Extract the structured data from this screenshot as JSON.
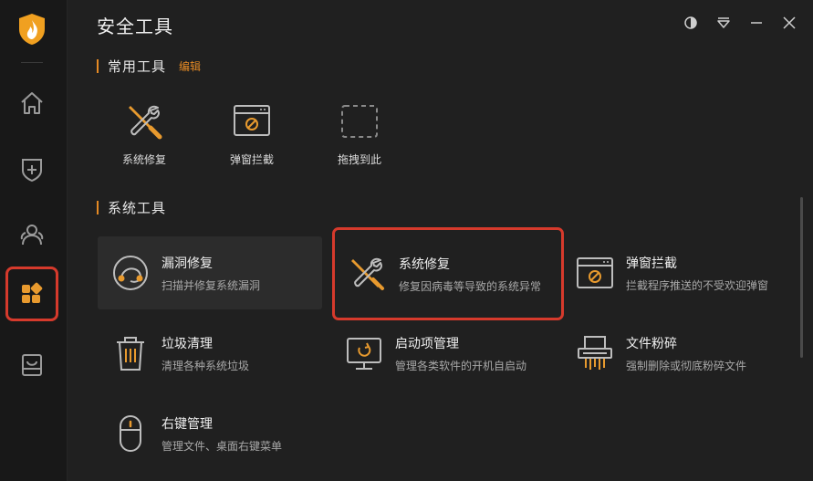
{
  "window": {
    "title": "安全工具"
  },
  "sidebar": {
    "items": [
      {
        "name": "home",
        "icon": "home-icon"
      },
      {
        "name": "protection",
        "icon": "shield-plus-icon"
      },
      {
        "name": "users",
        "icon": "users-icon"
      },
      {
        "name": "tools",
        "icon": "grid-apps-icon",
        "active": true
      },
      {
        "name": "box",
        "icon": "inbox-icon"
      }
    ]
  },
  "common": {
    "title": "常用工具",
    "edit_label": "编辑",
    "items": [
      {
        "label": "系统修复",
        "icon": "wrench-screwdriver-icon"
      },
      {
        "label": "弹窗拦截",
        "icon": "popup-block-icon"
      },
      {
        "label": "拖拽到此",
        "icon": "dashed-drop-icon"
      }
    ]
  },
  "system": {
    "title": "系统工具",
    "tools": [
      {
        "name": "漏洞修复",
        "desc": "扫描并修复系统漏洞",
        "icon": "patch-ring-icon"
      },
      {
        "name": "系统修复",
        "desc": "修复因病毒等导致的系统异常",
        "icon": "wrench-screwdriver-icon"
      },
      {
        "name": "弹窗拦截",
        "desc": "拦截程序推送的不受欢迎弹窗",
        "icon": "popup-block-icon"
      },
      {
        "name": "垃圾清理",
        "desc": "清理各种系统垃圾",
        "icon": "trash-icon"
      },
      {
        "name": "启动项管理",
        "desc": "管理各类软件的开机自启动",
        "icon": "monitor-startup-icon"
      },
      {
        "name": "文件粉碎",
        "desc": "强制删除或彻底粉碎文件",
        "icon": "shredder-icon"
      },
      {
        "name": "右键管理",
        "desc": "管理文件、桌面右键菜单",
        "icon": "mouse-icon"
      }
    ]
  },
  "colors": {
    "accent": "#e58a24",
    "highlight": "#d63a2c",
    "background": "#202020",
    "sidebar": "#181818"
  }
}
